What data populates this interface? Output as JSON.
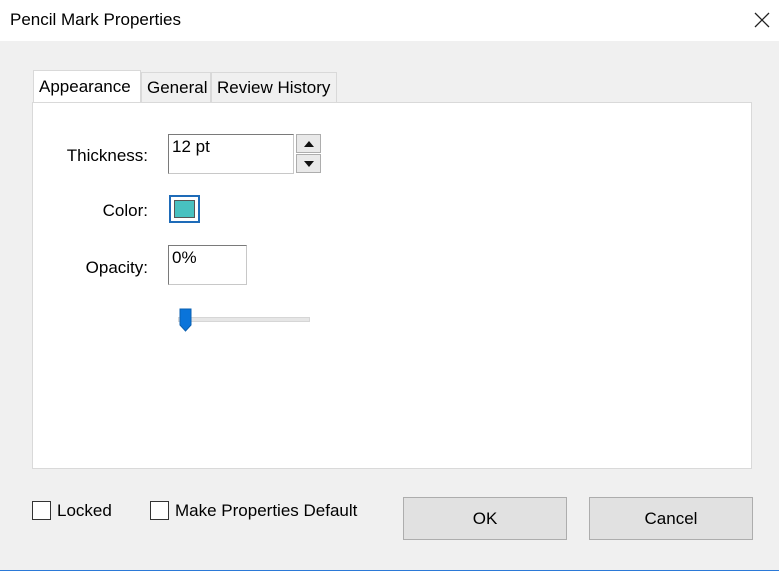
{
  "window": {
    "title": "Pencil Mark Properties",
    "close_icon": "close-icon"
  },
  "tabs": [
    {
      "label": "Appearance",
      "active": true
    },
    {
      "label": "General",
      "active": false
    },
    {
      "label": "Review History",
      "active": false
    }
  ],
  "appearance": {
    "thickness_label": "Thickness:",
    "thickness_value": "12 pt",
    "color_label": "Color:",
    "color_value": "#48c1c0",
    "opacity_label": "Opacity:",
    "opacity_value": "0%",
    "opacity_slider_level": 0
  },
  "footer": {
    "locked_label": "Locked",
    "locked_checked": false,
    "default_label": "Make Properties Default",
    "default_checked": false,
    "ok_label": "OK",
    "cancel_label": "Cancel"
  },
  "colors": {
    "accent": "#1e6bb8",
    "dialog_bg": "#f0f0f0",
    "slider_thumb": "#0a74da"
  }
}
